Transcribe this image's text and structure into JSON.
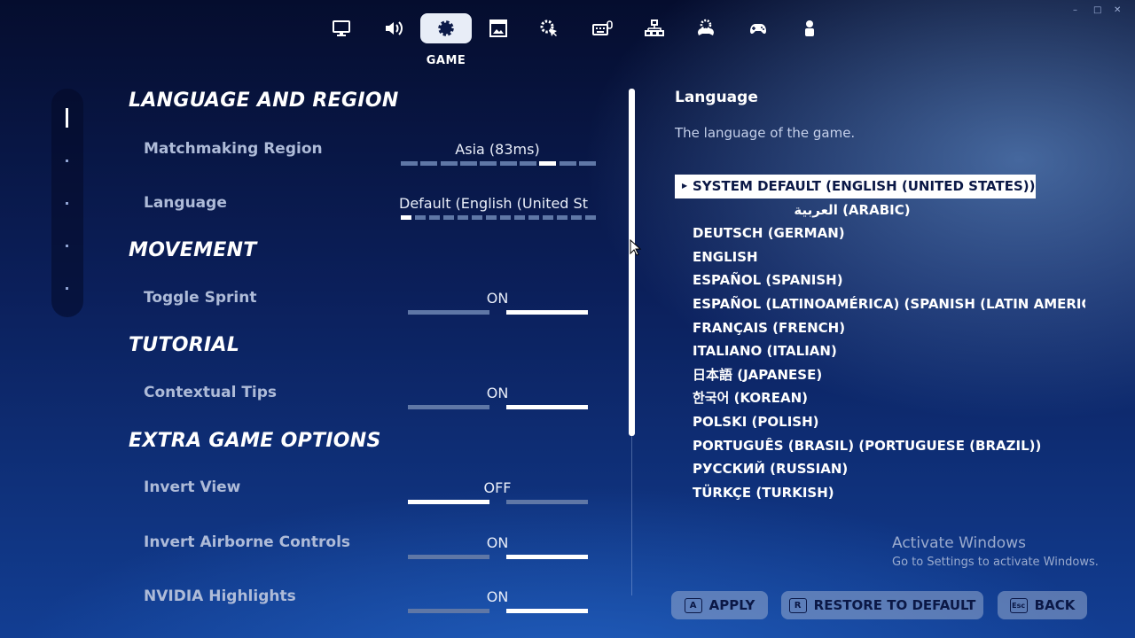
{
  "window": {
    "controls": [
      "–",
      "□",
      "✕"
    ]
  },
  "topnav": {
    "tabs": [
      {
        "icon": "monitor-icon",
        "active": false
      },
      {
        "icon": "audio-icon",
        "active": false
      },
      {
        "icon": "gear-icon",
        "active": true
      },
      {
        "icon": "display-ui-icon",
        "active": false
      },
      {
        "icon": "touch-settings-icon",
        "active": false
      },
      {
        "icon": "keyboard-mouse-icon",
        "active": false
      },
      {
        "icon": "controller-layout-icon",
        "active": false
      },
      {
        "icon": "controller-settings-icon",
        "active": false
      },
      {
        "icon": "gamepad-icon",
        "active": false
      },
      {
        "icon": "account-icon",
        "active": false
      }
    ],
    "active_caption": "GAME"
  },
  "sections": {
    "language_region": "LANGUAGE AND REGION",
    "movement": "MOVEMENT",
    "tutorial": "TUTORIAL",
    "extra": "EXTRA GAME OPTIONS"
  },
  "settings": {
    "matchmaking": {
      "label": "Matchmaking Region",
      "value": "Asia (83ms)",
      "segments": 10,
      "selected_index": 7
    },
    "language": {
      "label": "Language",
      "value": "Default (English (United St",
      "segments": 14,
      "selected_index": 0
    },
    "toggle_sprint": {
      "label": "Toggle Sprint",
      "value": "ON"
    },
    "contextual_tips": {
      "label": "Contextual Tips",
      "value": "ON"
    },
    "invert_view": {
      "label": "Invert View",
      "value": "OFF"
    },
    "invert_airborne": {
      "label": "Invert Airborne Controls",
      "value": "ON"
    },
    "nvidia": {
      "label": "NVIDIA Highlights",
      "value": "ON"
    }
  },
  "detail": {
    "title": "Language",
    "description": "The language of the game.",
    "options": [
      "SYSTEM DEFAULT (ENGLISH (UNITED STATES))",
      "العربية (ARABIC)",
      "DEUTSCH (GERMAN)",
      "ENGLISH",
      "ESPAÑOL (SPANISH)",
      "ESPAÑOL (LATINOAMÉRICA) (SPANISH (LATIN AMERICA",
      "FRANÇAIS (FRENCH)",
      "ITALIANO (ITALIAN)",
      "日本語 (JAPANESE)",
      "한국어 (KOREAN)",
      "POLSKI (POLISH)",
      "PORTUGUÊS (BRASIL) (PORTUGUESE (BRAZIL))",
      "РУССКИЙ (RUSSIAN)",
      "TÜRKÇE (TURKISH)"
    ],
    "selected_index": 0
  },
  "watermark": {
    "line1": "Activate Windows",
    "line2": "Go to Settings to activate Windows."
  },
  "buttons": {
    "apply": {
      "key": "A",
      "label": "APPLY"
    },
    "restore": {
      "key": "R",
      "label": "RESTORE TO DEFAULT"
    },
    "back": {
      "key": "Esc",
      "label": "BACK"
    }
  },
  "colors": {
    "accent": "#ffffff",
    "bg_top": "#050d2e",
    "bg_bottom": "#123e93",
    "inactive_bar": "#5f77a6"
  }
}
